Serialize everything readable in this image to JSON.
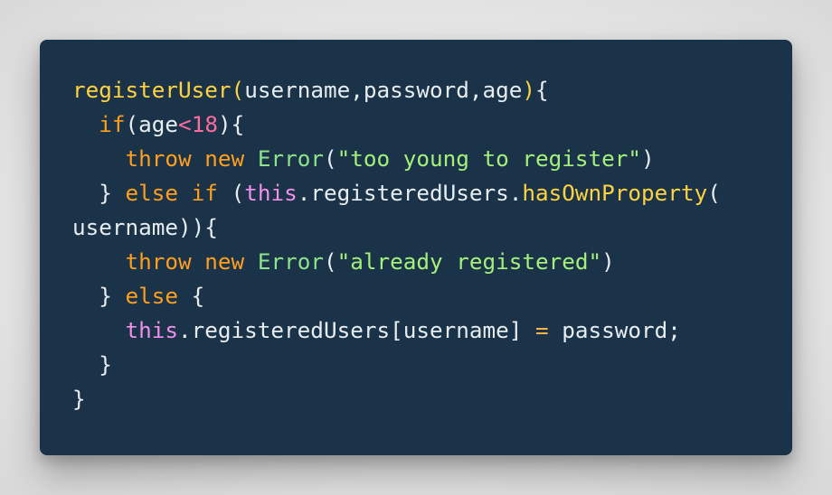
{
  "code": {
    "language": "javascript",
    "lines": [
      [
        {
          "t": "registerUser",
          "c": "fn"
        },
        {
          "t": "(",
          "c": "fn"
        },
        {
          "t": "username,password,age",
          "c": "plain"
        },
        {
          "t": ")",
          "c": "fn"
        },
        {
          "t": "{",
          "c": "plain"
        }
      ],
      [
        {
          "t": "  ",
          "c": "plain"
        },
        {
          "t": "if",
          "c": "kw"
        },
        {
          "t": "(age",
          "c": "plain"
        },
        {
          "t": "<",
          "c": "num"
        },
        {
          "t": "18",
          "c": "num"
        },
        {
          "t": "){",
          "c": "plain"
        }
      ],
      [
        {
          "t": "    ",
          "c": "plain"
        },
        {
          "t": "throw",
          "c": "kw"
        },
        {
          "t": " ",
          "c": "plain"
        },
        {
          "t": "new",
          "c": "kw"
        },
        {
          "t": " ",
          "c": "plain"
        },
        {
          "t": "Error",
          "c": "cls"
        },
        {
          "t": "(",
          "c": "plain"
        },
        {
          "t": "\"too young to register\"",
          "c": "str"
        },
        {
          "t": ")",
          "c": "plain"
        }
      ],
      [
        {
          "t": "  } ",
          "c": "plain"
        },
        {
          "t": "else",
          "c": "kw"
        },
        {
          "t": " ",
          "c": "plain"
        },
        {
          "t": "if",
          "c": "kw"
        },
        {
          "t": " (",
          "c": "plain"
        },
        {
          "t": "this",
          "c": "this"
        },
        {
          "t": ".registeredUsers.",
          "c": "plain"
        },
        {
          "t": "hasOwnProperty",
          "c": "fn"
        },
        {
          "t": "(",
          "c": "plain"
        }
      ],
      [
        {
          "t": "username)){",
          "c": "plain"
        }
      ],
      [
        {
          "t": "    ",
          "c": "plain"
        },
        {
          "t": "throw",
          "c": "kw"
        },
        {
          "t": " ",
          "c": "plain"
        },
        {
          "t": "new",
          "c": "kw"
        },
        {
          "t": " ",
          "c": "plain"
        },
        {
          "t": "Error",
          "c": "cls"
        },
        {
          "t": "(",
          "c": "plain"
        },
        {
          "t": "\"already registered\"",
          "c": "str"
        },
        {
          "t": ")",
          "c": "plain"
        }
      ],
      [
        {
          "t": "  } ",
          "c": "plain"
        },
        {
          "t": "else",
          "c": "kw"
        },
        {
          "t": " {",
          "c": "plain"
        }
      ],
      [
        {
          "t": "    ",
          "c": "plain"
        },
        {
          "t": "this",
          "c": "this"
        },
        {
          "t": ".registeredUsers[username] ",
          "c": "plain"
        },
        {
          "t": "=",
          "c": "op"
        },
        {
          "t": " password;",
          "c": "plain"
        }
      ],
      [
        {
          "t": "  }",
          "c": "plain"
        }
      ],
      [
        {
          "t": "}",
          "c": "plain"
        }
      ]
    ]
  },
  "colors": {
    "background": "#1a3349",
    "function": "#ffd23f",
    "keyword": "#ff9f1c",
    "number": "#ff6b9d",
    "string": "#a5f07a",
    "class": "#8fe388",
    "this": "#f28fe8",
    "text": "#e8edf2"
  }
}
